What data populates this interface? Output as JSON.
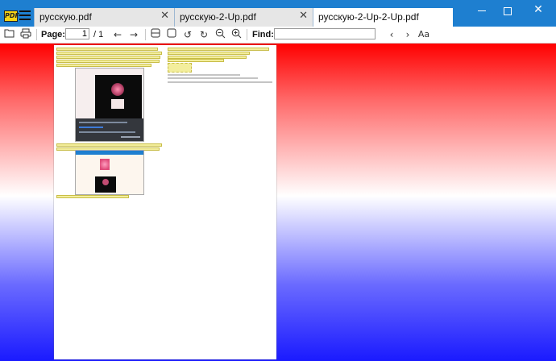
{
  "window": {
    "app_logo_text": "PDF",
    "tabs": [
      {
        "label": "русскую.pdf",
        "close": "✕",
        "active": false
      },
      {
        "label": "русскую-2-Up.pdf",
        "close": "✕",
        "active": false
      },
      {
        "label": "русскую-2-Up-2-Up.pdf",
        "close": "✕",
        "active": true
      }
    ],
    "controls": {
      "close": "✕"
    }
  },
  "toolbar": {
    "page_label": "Page:",
    "page_value": "1",
    "page_total": "/ 1",
    "find_label": "Find:",
    "find_value": "",
    "match_case": "Aa",
    "icons": [
      "open-icon",
      "print-icon",
      "back-icon",
      "forward-icon",
      "fit-width-icon",
      "fit-page-icon",
      "rotate-left-icon",
      "rotate-right-icon",
      "zoom-out-icon",
      "zoom-in-icon",
      "find-prev-icon",
      "find-next-icon",
      "match-case-icon"
    ]
  },
  "colors": {
    "titlebar": "#1e7fd0",
    "canvas_top": "#ff0000",
    "canvas_middle": "#ffffff",
    "canvas_bottom": "#1a1aff",
    "highlight": "#f3ee9c"
  },
  "document": {
    "pages_visible": 1
  }
}
